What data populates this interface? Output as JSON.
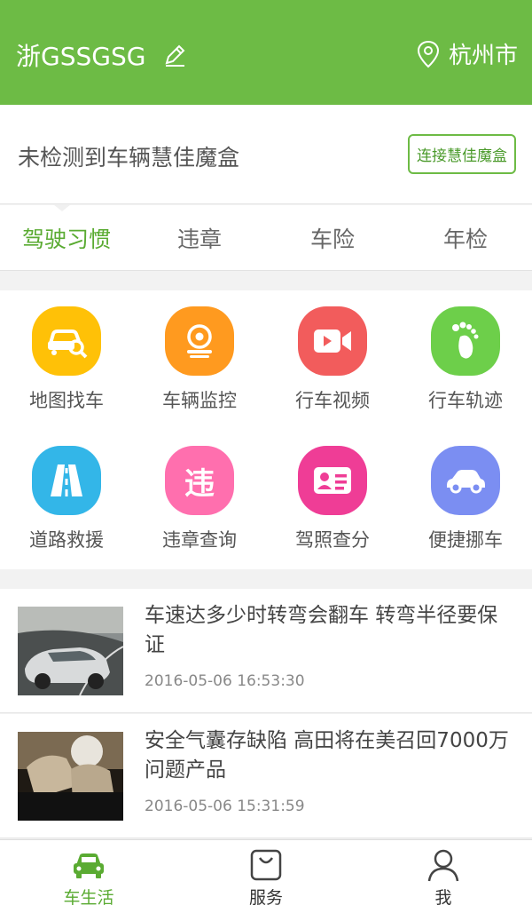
{
  "header": {
    "plate": "浙GSSGSG",
    "city": "杭州市"
  },
  "device": {
    "message": "未检测到车辆慧佳魔盒",
    "connect_label": "连接慧佳魔盒"
  },
  "tabs": [
    {
      "label": "驾驶习惯",
      "active": true
    },
    {
      "label": "违章"
    },
    {
      "label": "车险"
    },
    {
      "label": "年检"
    }
  ],
  "grid": [
    {
      "label": "地图找车",
      "icon": "car-search-icon",
      "color": "#ffc107"
    },
    {
      "label": "车辆监控",
      "icon": "camera-icon",
      "color": "#ff9a1f"
    },
    {
      "label": "行车视频",
      "icon": "video-icon",
      "color": "#f25c5c"
    },
    {
      "label": "行车轨迹",
      "icon": "footprint-icon",
      "color": "#6dcf4a"
    },
    {
      "label": "道路救援",
      "icon": "road-icon",
      "color": "#33b6e8"
    },
    {
      "label": "违章查询",
      "icon": "violation-icon",
      "color": "#ff6fae"
    },
    {
      "label": "驾照查分",
      "icon": "license-icon",
      "color": "#ef3d96"
    },
    {
      "label": "便捷挪车",
      "icon": "car-move-icon",
      "color": "#7b8ef2"
    }
  ],
  "news": [
    {
      "title": "车速达多少时转弯会翻车 转弯半径要保证",
      "time": "2016-05-06 16:53:30"
    },
    {
      "title": "安全气囊存缺陷 高田将在美召回7000万问题产品",
      "time": "2016-05-06 15:31:59"
    }
  ],
  "bottom_nav": [
    {
      "label": "车生活",
      "icon": "car-icon",
      "active": true
    },
    {
      "label": "服务",
      "icon": "bag-icon"
    },
    {
      "label": "我",
      "icon": "user-icon"
    }
  ],
  "colors": {
    "brand": "#6dbb45",
    "active": "#5aab32"
  }
}
